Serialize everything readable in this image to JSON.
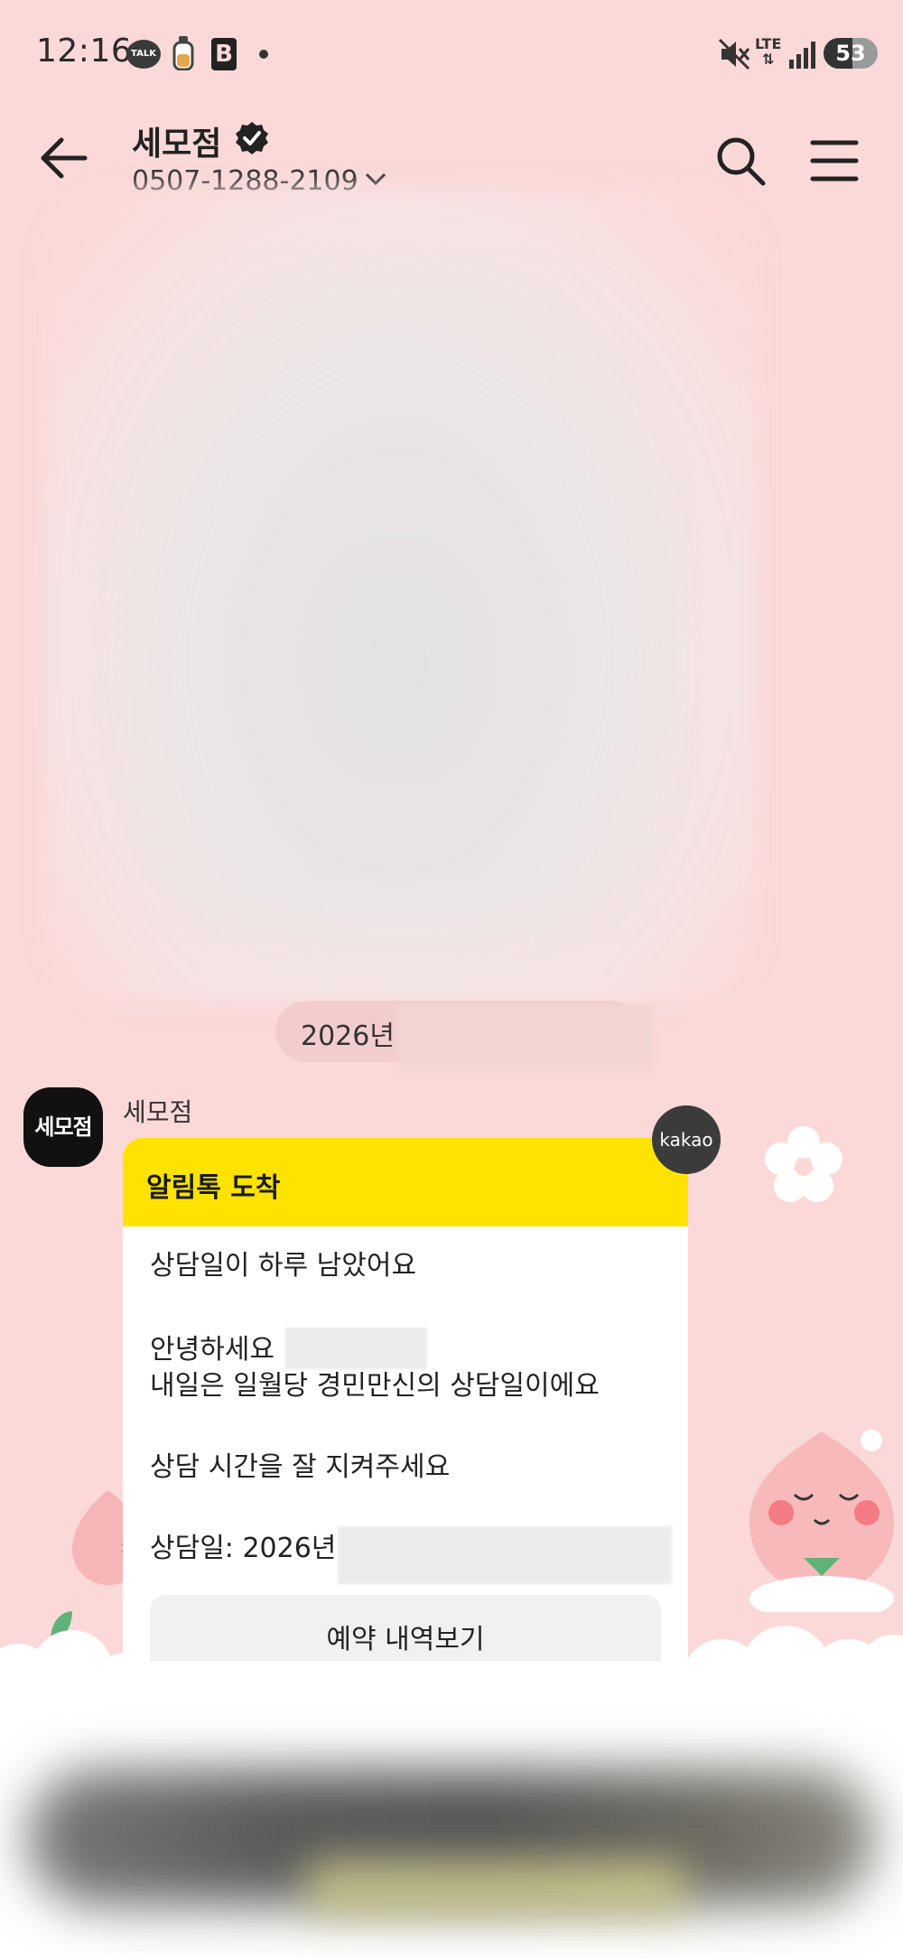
{
  "status_bar": {
    "time": "12:16",
    "talk_icon_label": "TALK",
    "b_icon_label": "B",
    "network_label": "LTE",
    "battery_level": "53",
    "battery_percent": 53
  },
  "header": {
    "title": "세모점",
    "phone": "0507-1288-2109"
  },
  "chat": {
    "date_prefix": "2026년",
    "sender_name": "세모점",
    "avatar_label": "세모점",
    "badge_label": "kakao",
    "card": {
      "header": "알림톡 도착",
      "line1": "상담일이 하루 남았어요",
      "line2": "안녕하세요",
      "line3": "내일은 일월당 경민만신의 상담일이에요",
      "line4": "상담 시간을 잘 지켜주세요",
      "line5": "상담일: 2026년",
      "button_label": "예약 내역보기"
    }
  },
  "colors": {
    "background": "#fbd9d8",
    "card_header": "#ffe300",
    "avatar_bg": "#111111",
    "kakao_badge": "#3b3b3b"
  }
}
